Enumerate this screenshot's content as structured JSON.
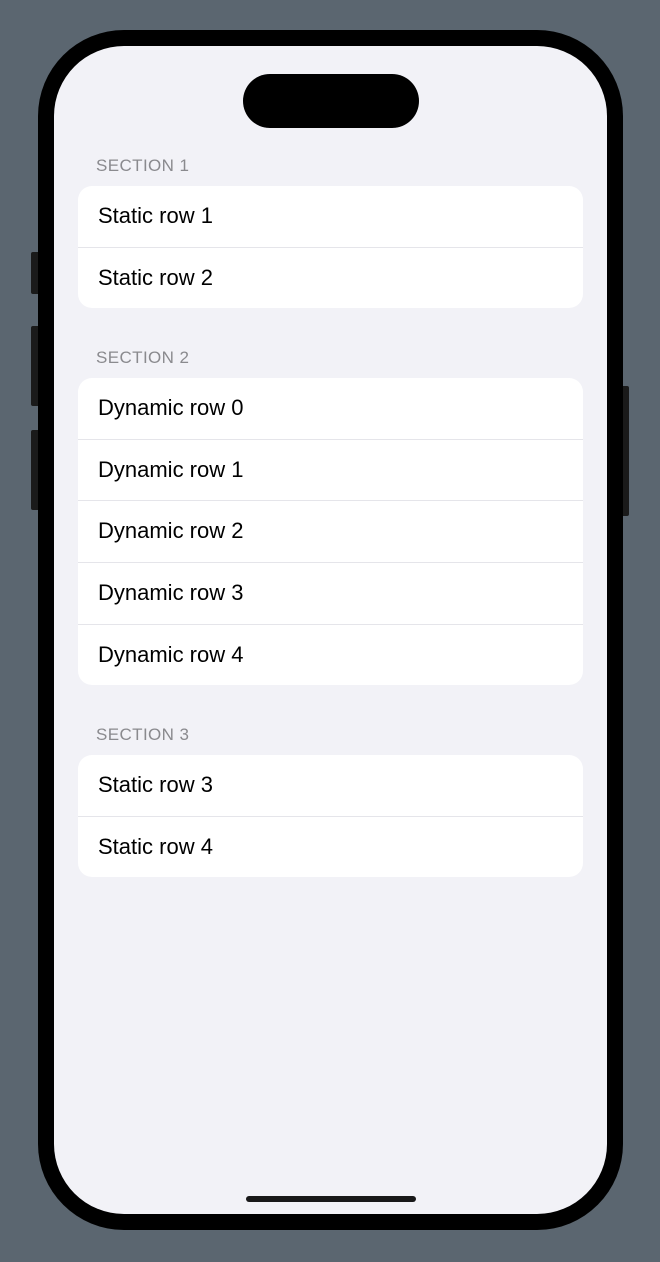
{
  "sections": [
    {
      "header": "Section 1",
      "rows": [
        "Static row 1",
        "Static row 2"
      ]
    },
    {
      "header": "Section 2",
      "rows": [
        "Dynamic row 0",
        "Dynamic row 1",
        "Dynamic row 2",
        "Dynamic row 3",
        "Dynamic row 4"
      ]
    },
    {
      "header": "Section 3",
      "rows": [
        "Static row 3",
        "Static row 4"
      ]
    }
  ]
}
